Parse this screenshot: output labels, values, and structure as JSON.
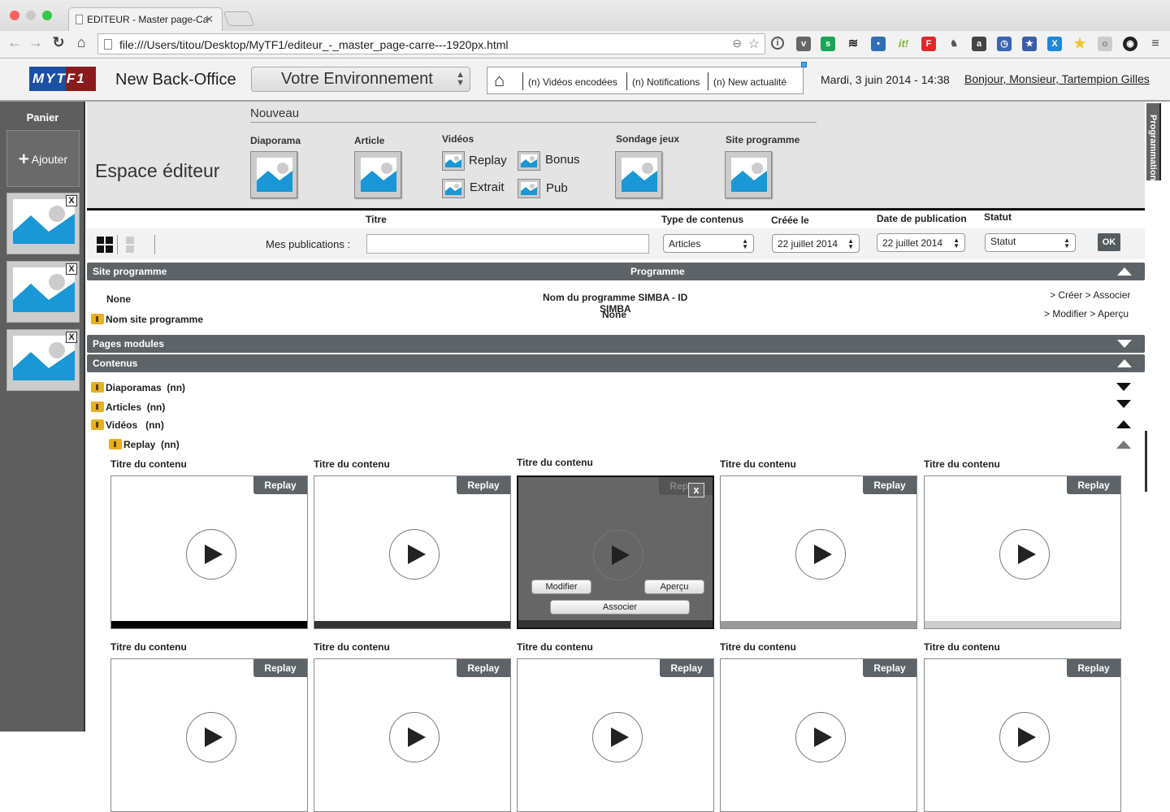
{
  "browser": {
    "tab_title": "EDITEUR - Master page-Ca",
    "url": "file:///Users/titou/Desktop/MyTF1/editeur_-_master_page-carre---1920px.html",
    "extensions": [
      "1password-icon",
      "pocket-icon",
      "green-sync-icon",
      "buffer-icon",
      "tweetbot-icon",
      "scoopit-icon",
      "flipboard-icon",
      "evernote-icon",
      "amazon-icon",
      "clock-icon",
      "star-bookmark-icon",
      "x-extension-icon",
      "yellow-star-icon",
      "office-icon",
      "color-picker-icon"
    ]
  },
  "header": {
    "logo": "MYTF1",
    "app_title": "New Back-Office",
    "environment_select": "Votre Environnement",
    "notifications": [
      "(n) Vidéos encodées",
      "(n) Notifications",
      "(n) New actualité"
    ],
    "date": "Mardi, 3 juin 2014 - 14:38",
    "user_greeting": "Bonjour, Monsieur, Tartempion Gilles"
  },
  "sidebar": {
    "title": "Panier",
    "add_label": "Ajouter",
    "close_label": "X",
    "thumbs": 3
  },
  "right_tab": "Programmation",
  "espace": {
    "title": "Espace éditeur",
    "nouveau": "Nouveau",
    "categories": {
      "diaporama": "Diaporama",
      "article": "Article",
      "videos": "Vidéos",
      "sondage": "Sondage jeux",
      "site": "Site programme"
    },
    "video_types": [
      "Replay",
      "Bonus",
      "Extrait",
      "Pub"
    ]
  },
  "filters": {
    "titre_label": "Titre",
    "mes_publications": "Mes publications :",
    "titre_value": "",
    "type_label": "Type de contenus",
    "type_value": "Articles",
    "creee_label": "Créée le",
    "creee_value": "22 juillet 2014",
    "pub_label": "Date de publication",
    "pub_value": "22 juillet 2014",
    "statut_label": "Statut",
    "statut_value": "Statut",
    "ok": "OK"
  },
  "site_programme": {
    "header_left": "Site programme",
    "header_center": "Programme",
    "none": "None",
    "nom_site": "Nom site programme",
    "nom_programme": "Nom du programme SIMBA - ID",
    "simba": "SIMBA",
    "none2": "None",
    "actions1": "> Créer > Associer",
    "actions2": "> Modifier > Aperçu"
  },
  "pages_modules": "Pages modules",
  "contenus": {
    "header": "Contenus",
    "folders": [
      {
        "label": "Diaporamas",
        "count": "(nn)"
      },
      {
        "label": "Articles",
        "count": "(nn)"
      },
      {
        "label": "Vidéos",
        "count": "(nn)"
      }
    ],
    "subfolder": {
      "label": "Replay",
      "count": "(nn)"
    }
  },
  "cards_row1": [
    {
      "title": "Titre du contenu",
      "tag": "Replay",
      "bar": "#000000"
    },
    {
      "title": "Titre du contenu",
      "tag": "Replay",
      "bar": "#333333"
    },
    {
      "title": "Titre du contenu",
      "tag": "Replay",
      "bar": "#333333",
      "hover": true
    },
    {
      "title": "Titre du contenu",
      "tag": "Replay",
      "bar": "#999999"
    },
    {
      "title": "Titre du contenu",
      "tag": "Replay",
      "bar": "#cccccc"
    }
  ],
  "cards_row2": [
    {
      "title": "Titre du contenu",
      "tag": "Replay"
    },
    {
      "title": "Titre du contenu",
      "tag": "Replay"
    },
    {
      "title": "Titre du contenu",
      "tag": "Replay"
    },
    {
      "title": "Titre du contenu",
      "tag": "Replay"
    },
    {
      "title": "Titre du contenu",
      "tag": "Replay"
    }
  ],
  "hover_actions": {
    "modifier": "Modifier",
    "apercu": "Aperçu",
    "associer": "Associer",
    "close": "x"
  }
}
